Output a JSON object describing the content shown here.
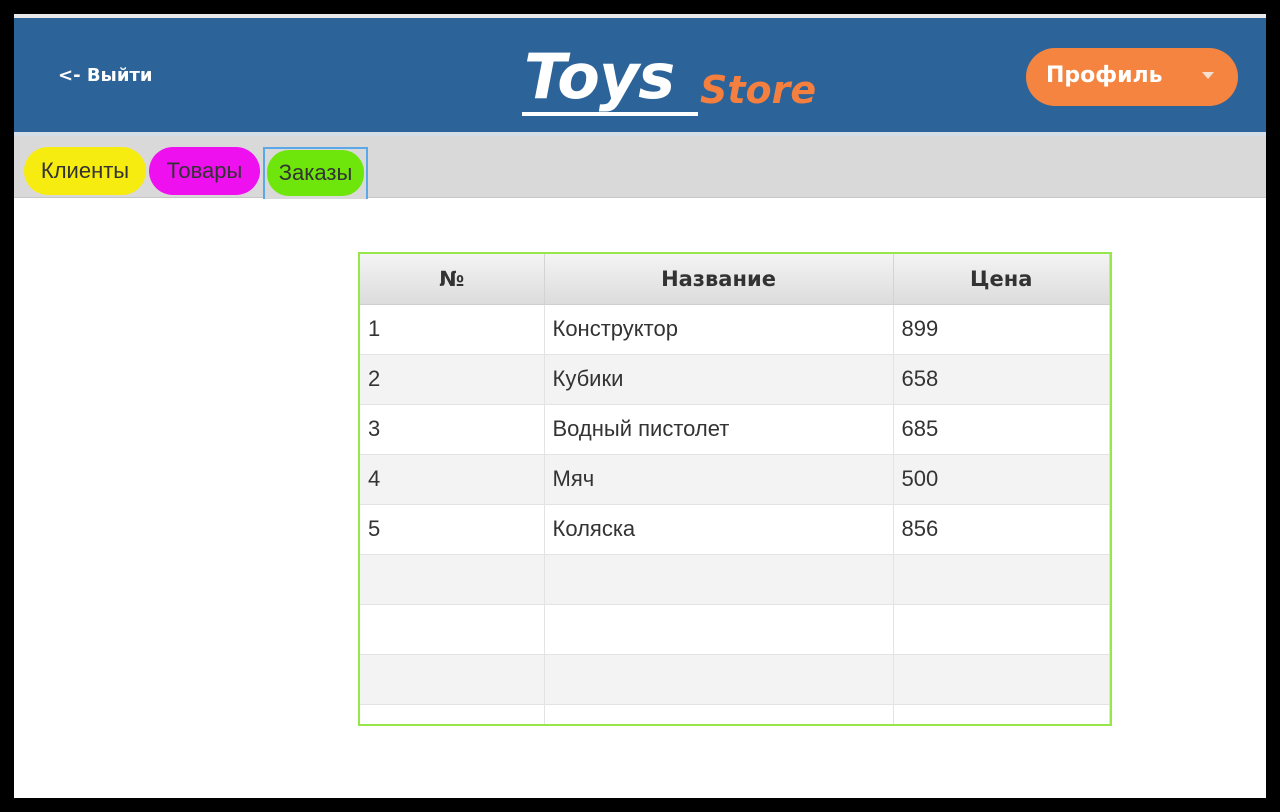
{
  "header": {
    "back_label": "<- Выйти",
    "logo_main": "Toys",
    "logo_sub": "Store",
    "profile_label": "Профиль"
  },
  "tabs": [
    {
      "label": "Клиенты",
      "color": "#f7ec10"
    },
    {
      "label": "Товары",
      "color": "#ee10ee"
    },
    {
      "label": "Заказы",
      "color": "#6ee60c",
      "selected": true
    }
  ],
  "table": {
    "columns": [
      "№",
      "Название",
      "Цена"
    ],
    "rows": [
      [
        "1",
        "Конструктор",
        "899"
      ],
      [
        "2",
        "Кубики",
        "658"
      ],
      [
        "3",
        "Водный пистолет",
        "685"
      ],
      [
        "4",
        "Мяч",
        "500"
      ],
      [
        "5",
        "Коляска",
        "856"
      ]
    ],
    "empty_rows": 4
  },
  "colors": {
    "header_bg": "#2c6399",
    "accent_orange": "#f48440",
    "table_border": "#96e84a"
  }
}
